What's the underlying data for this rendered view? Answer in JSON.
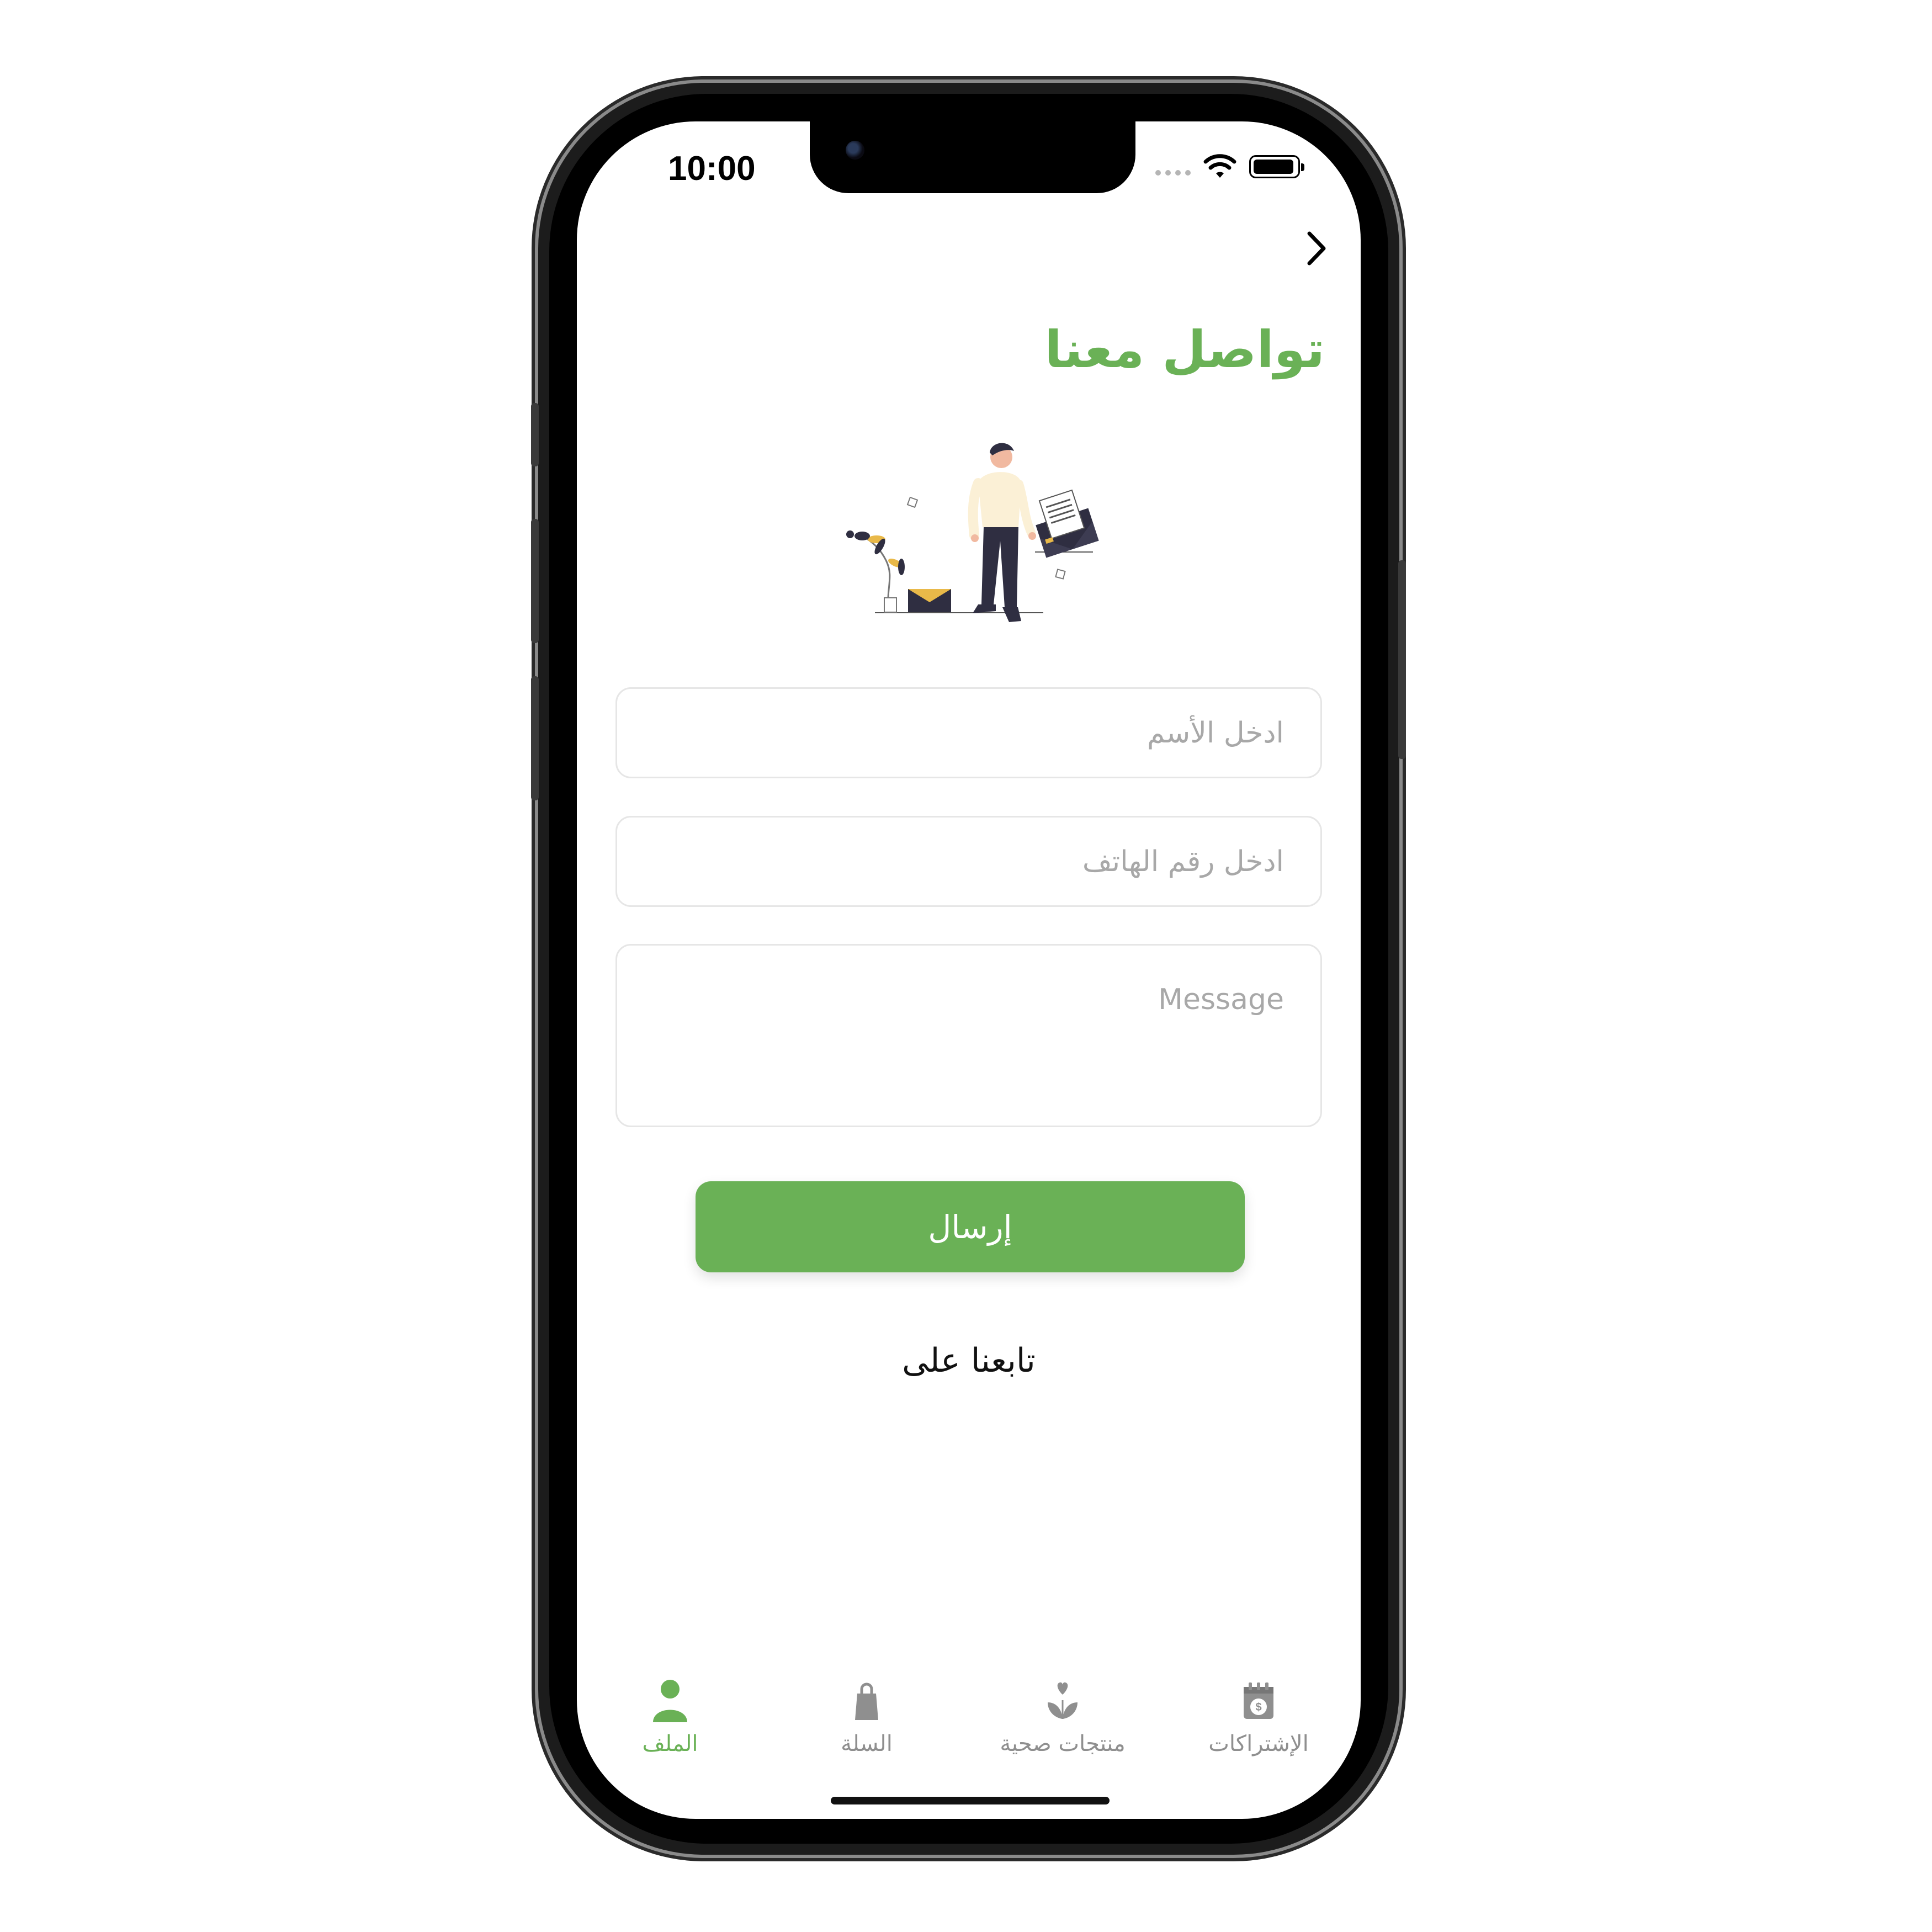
{
  "status": {
    "time": "10:00"
  },
  "page": {
    "title": "تواصل معنا"
  },
  "form": {
    "name_placeholder": "ادخل الأسم",
    "phone_placeholder": "ادخل رقم الهاتف",
    "message_placeholder": "Message",
    "submit_label": "إرسال"
  },
  "follow_label": "تابعنا على",
  "tabbar": {
    "items": [
      {
        "label": "الملف",
        "icon": "profile-icon",
        "active": true
      },
      {
        "label": "السلة",
        "icon": "bag-icon",
        "active": false
      },
      {
        "label": "منتجات صحية",
        "icon": "plant-heart-icon",
        "active": false
      },
      {
        "label": "الإشتراكات",
        "icon": "calendar-dollar-icon",
        "active": false
      }
    ]
  },
  "colors": {
    "accent": "#6ab156",
    "placeholder": "#a8a8a8",
    "border": "#e6e6e6",
    "tab_inactive": "#8f8f8f"
  }
}
